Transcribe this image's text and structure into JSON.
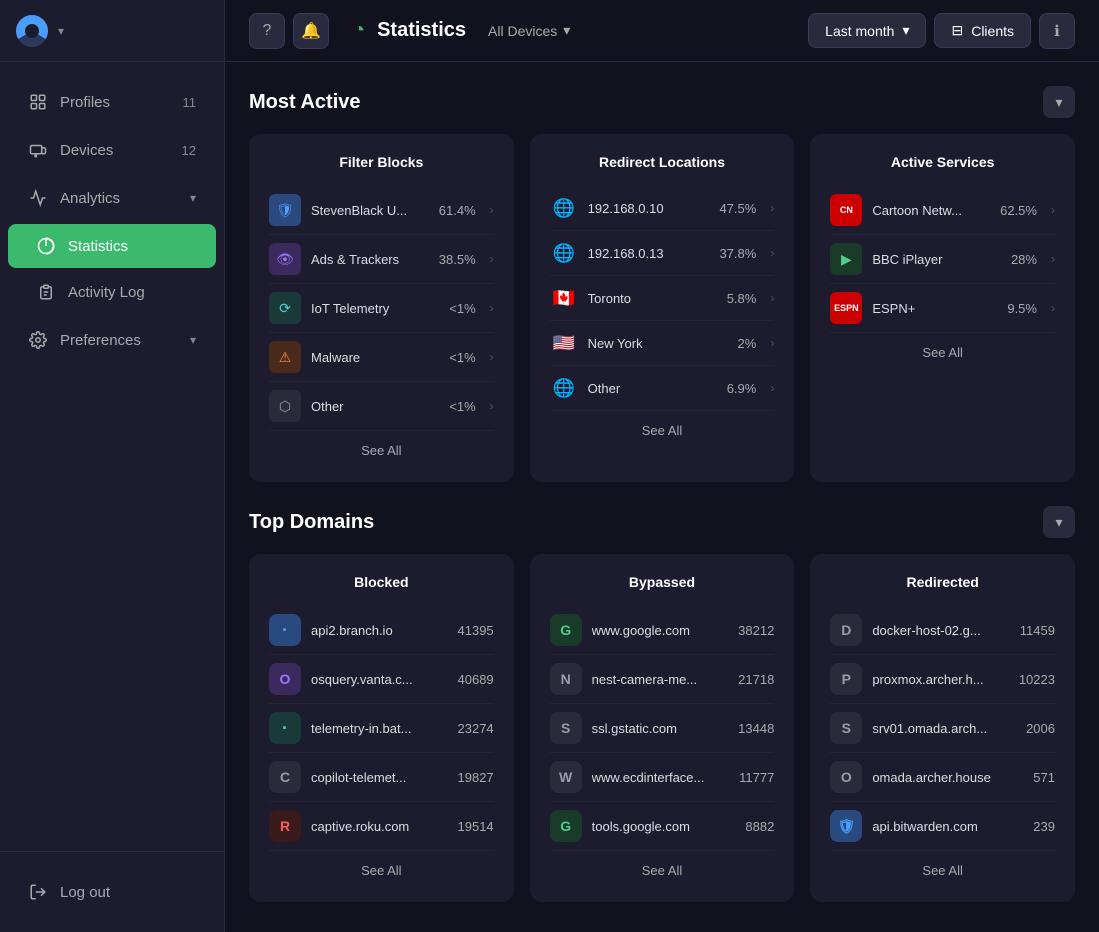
{
  "app": {
    "logo_alt": "App Logo"
  },
  "sidebar": {
    "profiles_label": "Profiles",
    "profiles_count": "11",
    "devices_label": "Devices",
    "devices_count": "12",
    "analytics_label": "Analytics",
    "statistics_label": "Statistics",
    "activity_log_label": "Activity Log",
    "preferences_label": "Preferences",
    "logout_label": "Log out"
  },
  "topbar": {
    "page_title": "Statistics",
    "device_filter_label": "All Devices",
    "period_label": "Last month",
    "clients_label": "Clients"
  },
  "most_active": {
    "section_title": "Most Active",
    "filter_blocks": {
      "card_title": "Filter Blocks",
      "rows": [
        {
          "label": "StevenBlack U...",
          "pct": "61.4%",
          "icon_type": "shield"
        },
        {
          "label": "Ads & Trackers",
          "pct": "38.5%",
          "icon_type": "eye"
        },
        {
          "label": "IoT Telemetry",
          "pct": "<1%",
          "icon_type": "iot"
        },
        {
          "label": "Malware",
          "pct": "<1%",
          "icon_type": "malware"
        },
        {
          "label": "Other",
          "pct": "<1%",
          "icon_type": "box"
        }
      ],
      "see_all": "See All"
    },
    "redirect_locations": {
      "card_title": "Redirect Locations",
      "rows": [
        {
          "label": "192.168.0.10",
          "pct": "47.5%",
          "flag": "🌐"
        },
        {
          "label": "192.168.0.13",
          "pct": "37.8%",
          "flag": "🌐"
        },
        {
          "label": "Toronto",
          "pct": "5.8%",
          "flag": "🇨🇦"
        },
        {
          "label": "New York",
          "pct": "2%",
          "flag": "🇺🇸"
        },
        {
          "label": "Other",
          "pct": "6.9%",
          "flag": "🌐"
        }
      ],
      "see_all": "See All"
    },
    "active_services": {
      "card_title": "Active Services",
      "rows": [
        {
          "label": "Cartoon Netw...",
          "pct": "62.5%",
          "icon_type": "cn"
        },
        {
          "label": "BBC iPlayer",
          "pct": "28%",
          "icon_type": "bbc"
        },
        {
          "label": "ESPN+",
          "pct": "9.5%",
          "icon_type": "espn"
        }
      ],
      "see_all": "See All"
    }
  },
  "top_domains": {
    "section_title": "Top Domains",
    "blocked": {
      "card_title": "Blocked",
      "rows": [
        {
          "label": "api2.branch.io",
          "count": "41395",
          "letter": "·",
          "color": "dot-blue"
        },
        {
          "label": "osquery.vanta.c...",
          "count": "40689",
          "letter": "O",
          "color": "dot-purple"
        },
        {
          "label": "telemetry-in.bat...",
          "count": "23274",
          "letter": "·",
          "color": "dot-teal"
        },
        {
          "label": "copilot-telemet...",
          "count": "19827",
          "letter": "C",
          "color": "dot-gray"
        },
        {
          "label": "captive.roku.com",
          "count": "19514",
          "letter": "R",
          "color": "dot-red"
        }
      ],
      "see_all": "See All"
    },
    "bypassed": {
      "card_title": "Bypassed",
      "rows": [
        {
          "label": "www.google.com",
          "count": "38212",
          "letter": "G",
          "color": "dot-green"
        },
        {
          "label": "nest-camera-me...",
          "count": "21718",
          "letter": "N",
          "color": "dot-gray"
        },
        {
          "label": "ssl.gstatic.com",
          "count": "13448",
          "letter": "S",
          "color": "dot-gray"
        },
        {
          "label": "www.ecdinterface...",
          "count": "11777",
          "letter": "W",
          "color": "dot-gray"
        },
        {
          "label": "tools.google.com",
          "count": "8882",
          "letter": "G",
          "color": "dot-green"
        }
      ],
      "see_all": "See All"
    },
    "redirected": {
      "card_title": "Redirected",
      "rows": [
        {
          "label": "docker-host-02.g...",
          "count": "11459",
          "letter": "D",
          "color": "dot-gray"
        },
        {
          "label": "proxmox.archer.h...",
          "count": "10223",
          "letter": "P",
          "color": "dot-gray"
        },
        {
          "label": "srv01.omada.arch...",
          "count": "2006",
          "letter": "S",
          "color": "dot-gray"
        },
        {
          "label": "omada.archer.house",
          "count": "571",
          "letter": "O",
          "color": "dot-gray"
        },
        {
          "label": "api.bitwarden.com",
          "count": "239",
          "letter": "🛡",
          "color": "dot-blue"
        }
      ],
      "see_all": "See All"
    }
  }
}
